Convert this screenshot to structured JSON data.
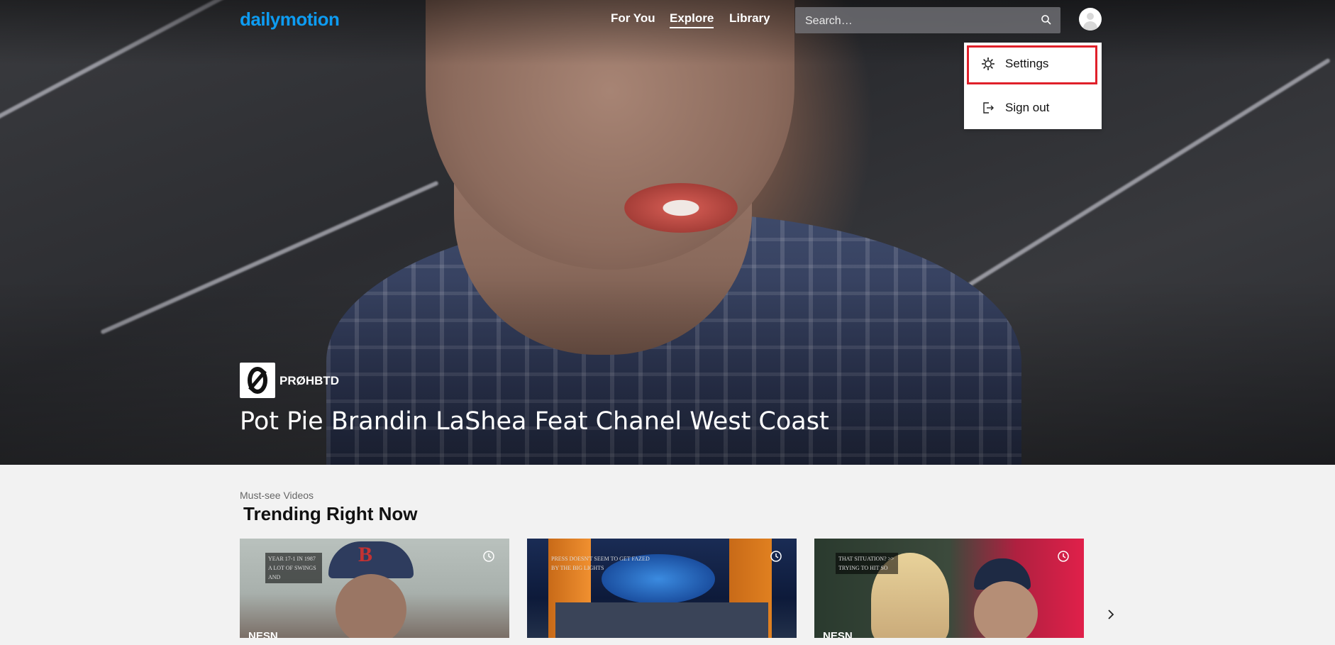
{
  "header": {
    "logo": "dailymotion",
    "nav": [
      {
        "label": "For You"
      },
      {
        "label": "Explore",
        "active": true
      },
      {
        "label": "Library"
      }
    ],
    "search": {
      "placeholder": "Search…",
      "icon": "search-icon"
    },
    "avatar_icon": "user-avatar-icon"
  },
  "dropdown": {
    "items": [
      {
        "label": "Settings",
        "icon": "gear-icon",
        "highlighted": true
      },
      {
        "label": "Sign out",
        "icon": "sign-out-icon"
      }
    ],
    "highlight_color": "#e0202a"
  },
  "hero": {
    "channel": "PRØHBTD",
    "channel_logo_glyph": "Ø",
    "title": "Pot Pie Brandin LaShea Feat Chanel West Coast"
  },
  "trending": {
    "subtitle": "Must-see Videos",
    "title": "Trending Right Now",
    "cards": [
      {
        "overlay": "YEAR 17-1 IN 1987 A LOT OF SWINGS AND",
        "tag": "NESN",
        "watch_later_icon": "clock-icon"
      },
      {
        "overlay": "PRESS DOESN'T SEEM TO GET FAZED BY THE BIG LIGHTS",
        "tag": "",
        "watch_later_icon": "clock-icon"
      },
      {
        "overlay": "THAT SITUATION? >> TRYING TO HIT SO",
        "tag": "NESN",
        "watch_later_icon": "clock-icon"
      }
    ],
    "next_icon": "chevron-right-icon"
  },
  "colors": {
    "brand": "#0d9cf2",
    "page_bg": "#f2f2f2"
  }
}
